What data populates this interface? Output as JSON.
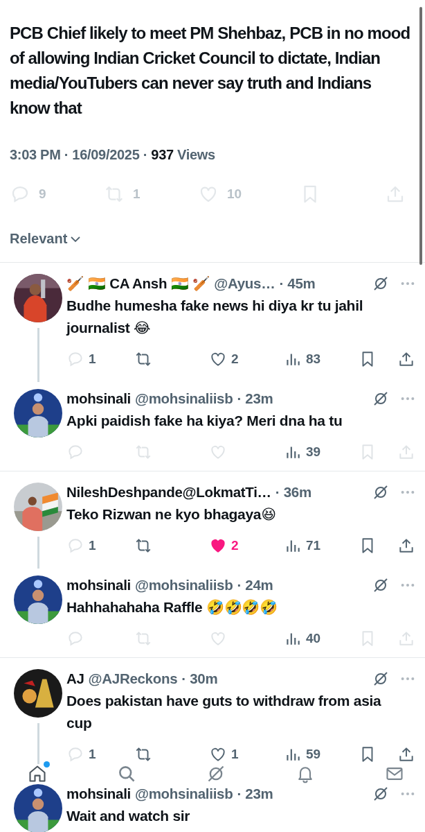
{
  "post": {
    "text": "PCB Chief likely to meet PM Shehbaz, PCB in no mood of allowing Indian Cricket Council to dictate, Indian media/YouTubers can never say truth and Indians know that",
    "time": "3:03 PM · 16/09/2025 · ",
    "views_count": "937",
    "views_label": "Views",
    "stats": {
      "replies": "9",
      "reposts": "1",
      "likes": "10"
    }
  },
  "sort": {
    "label": "Relevant"
  },
  "threads": [
    {
      "name": "🏏 🇮🇳 CA Ansh 🇮🇳 🏏",
      "handle": "@Ayus…",
      "time": "· 45m",
      "text": "Budhe humesha fake news hi diya kr tu jahil journalist 😂",
      "faded": false,
      "liked": false,
      "stats": {
        "replies": "1",
        "likes": "2",
        "views": "83"
      },
      "children": [
        {
          "name": "mohsinali",
          "handle": "@mohsinaliisb",
          "time": "· 23m",
          "text": "Apki paidish fake ha kiya? Meri dna ha tu",
          "faded": true,
          "liked": false,
          "stats": {
            "views": "39"
          }
        }
      ]
    },
    {
      "name": "NileshDeshpande@LokmatTi…",
      "time": "· 36m",
      "text": "Teko Rizwan ne kyo bhagaya😆",
      "faded": false,
      "liked": true,
      "stats": {
        "replies": "1",
        "likes": "2",
        "views": "71"
      },
      "children": [
        {
          "name": "mohsinali",
          "handle": "@mohsinaliisb",
          "time": "· 24m",
          "text": "Hahhahahaha Raffle 🤣🤣🤣🤣",
          "faded": true,
          "liked": false,
          "stats": {
            "views": "40"
          }
        }
      ]
    },
    {
      "name": "AJ",
      "handle": "@AJReckons",
      "time": "· 30m",
      "text": "Does pakistan have guts to withdraw from asia cup",
      "faded": false,
      "liked": false,
      "stats": {
        "replies": "1",
        "likes": "1",
        "views": "59"
      },
      "children": [
        {
          "name": "mohsinali",
          "handle": "@mohsinaliisb",
          "time": "· 23m",
          "text": "Wait and watch sir"
        }
      ]
    }
  ],
  "nav": [
    {
      "kind": "home",
      "selected": true,
      "dot": true
    },
    {
      "kind": "search",
      "selected": false,
      "dot": false
    },
    {
      "kind": "grok",
      "selected": false,
      "dot": false
    },
    {
      "kind": "bell",
      "selected": false,
      "dot": false
    },
    {
      "kind": "mail",
      "selected": false,
      "dot": false
    }
  ]
}
